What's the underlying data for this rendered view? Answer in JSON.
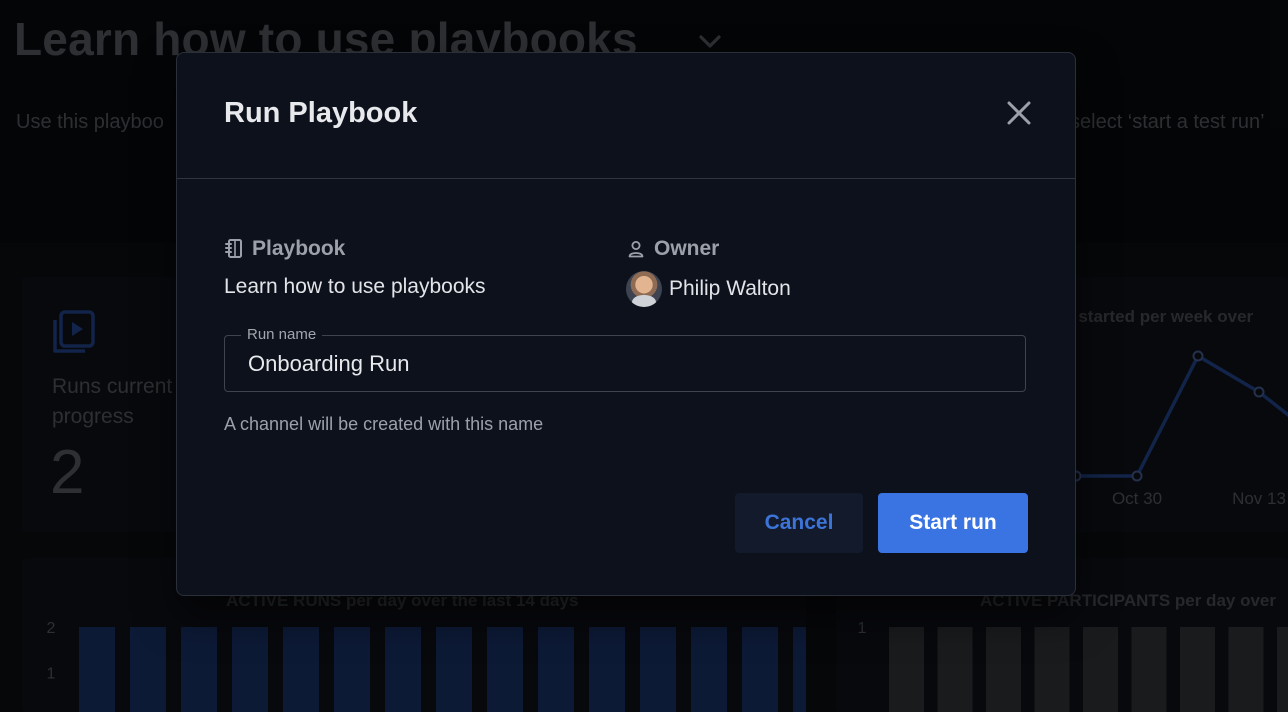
{
  "background": {
    "page_title": "Learn how to use playbooks",
    "description_left": "Use this playboo",
    "description_right": "select ‘start a test run’",
    "runs_card": {
      "label": "Runs current progress",
      "count": "2"
    },
    "line_chart": {
      "title": "NS started per week over"
    },
    "bar_chart_a": {
      "title": "ACTIVE RUNS per day over the last 14 days"
    },
    "bar_chart_b": {
      "title": "ACTIVE PARTICIPANTS per day over"
    }
  },
  "chart_data": [
    {
      "type": "line",
      "title": "NS started per week over",
      "x": [
        "",
        "Oct 30",
        "",
        "Nov 13",
        ""
      ],
      "tick_labels": [
        "Oct 30",
        "Nov 13"
      ],
      "series": [
        {
          "values": [
            0,
            0,
            2,
            1.4,
            0.6
          ]
        }
      ],
      "ylim": [
        0,
        2.2
      ],
      "grid": false,
      "color": "#1e3a78"
    },
    {
      "type": "bar",
      "title": "ACTIVE RUNS per day over the last 14 days",
      "categories": [
        "",
        "",
        "",
        "",
        "",
        "",
        "",
        "",
        "",
        "",
        "",
        "",
        "",
        "",
        ""
      ],
      "values": [
        2,
        2,
        2,
        2,
        2,
        2,
        2,
        2,
        2,
        2,
        2,
        2,
        2,
        2,
        2
      ],
      "y_ticks": [
        "2",
        "1"
      ],
      "ylim": [
        0,
        2
      ],
      "color": "#162a57"
    },
    {
      "type": "bar",
      "title": "ACTIVE PARTICIPANTS per day over",
      "categories": [
        "",
        "",
        "",
        "",
        "",
        "",
        "",
        "",
        ""
      ],
      "values": [
        1,
        1,
        1,
        1,
        1,
        1,
        1,
        1,
        1
      ],
      "y_ticks": [
        "1"
      ],
      "ylim": [
        0,
        1
      ],
      "color": "#2b2c30"
    }
  ],
  "modal": {
    "title": "Run Playbook",
    "playbook_label": "Playbook",
    "playbook_value": "Learn how to use playbooks",
    "owner_label": "Owner",
    "owner_name": "Philip Walton",
    "run_name_label": "Run name",
    "run_name_value": "Onboarding Run",
    "run_name_help": "A channel will be created with this name",
    "cancel_label": "Cancel",
    "start_label": "Start run"
  },
  "icons": {
    "close": "close-icon",
    "playbook": "notebook-icon",
    "owner": "person-icon",
    "chevron": "chevron-down-icon",
    "runs": "play-stack-icon"
  },
  "colors": {
    "primary": "#3a73e2",
    "modal_bg": "#0c111c",
    "line_series": "#1e3a78",
    "bar_runs": "#162a57",
    "bar_participants": "#2b2c30"
  }
}
